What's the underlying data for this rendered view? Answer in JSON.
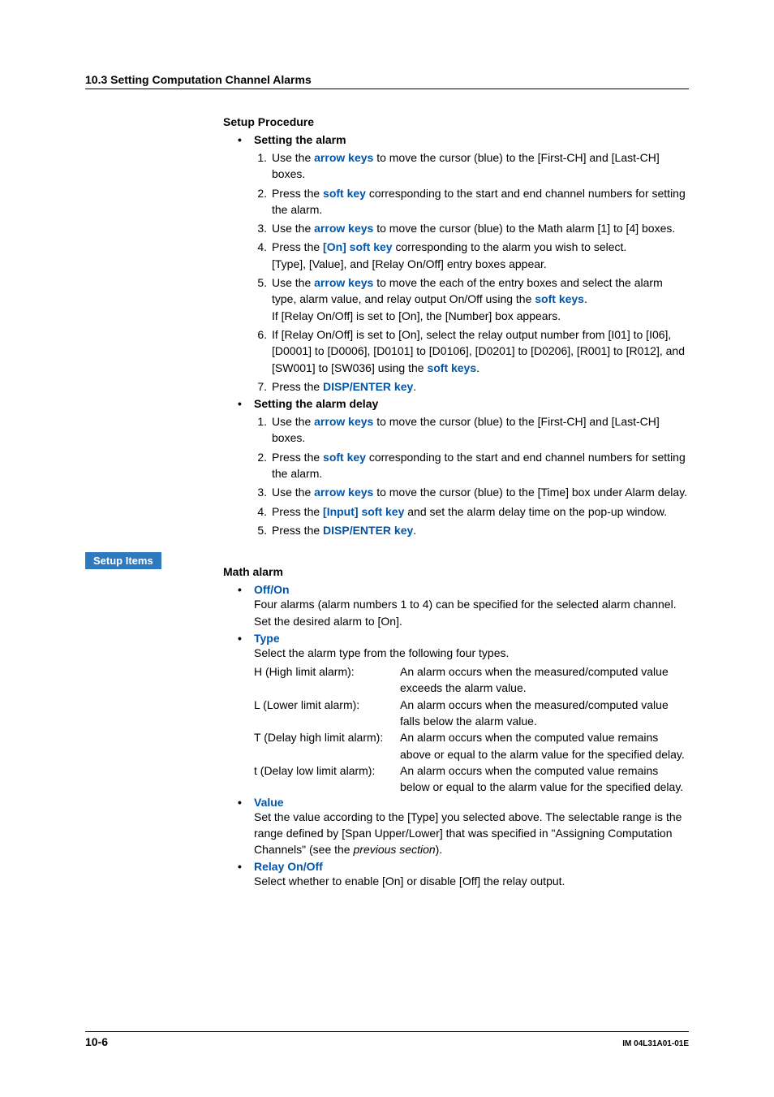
{
  "header": {
    "section": "10.3  Setting Computation Channel Alarms"
  },
  "setupProcedure": {
    "title": "Setup Procedure",
    "alarm": {
      "heading": "Setting the alarm",
      "steps": {
        "s1a": "Use the ",
        "s1b": "arrow keys",
        "s1c": " to move the cursor (blue) to the [First-CH] and [Last-CH] boxes.",
        "s2a": "Press the ",
        "s2b": "soft key",
        "s2c": " corresponding to the start and end channel numbers for setting the alarm.",
        "s3a": "Use the ",
        "s3b": "arrow keys",
        "s3c": " to move the cursor (blue) to the Math alarm [1] to [4] boxes.",
        "s4a": "Press the ",
        "s4b": "[On] soft key",
        "s4c": " corresponding to the alarm you wish to select.",
        "s4d": "[Type], [Value], and [Relay On/Off] entry boxes appear.",
        "s5a": "Use the ",
        "s5b": "arrow keys",
        "s5c": " to move the each of the entry boxes and select the alarm type, alarm value, and relay output On/Off using the ",
        "s5d": "soft keys",
        "s5e": ".",
        "s5f": "If [Relay On/Off] is set to [On], the [Number] box appears.",
        "s6a": "If [Relay On/Off] is set to [On], select the relay output number from [I01] to [I06], [D0001] to [D0006], [D0101] to [D0106], [D0201] to [D0206], [R001] to [R012], and [SW001] to [SW036] using the ",
        "s6b": "soft keys",
        "s6c": ".",
        "s7a": "Press the ",
        "s7b": "DISP/ENTER key",
        "s7c": "."
      }
    },
    "delay": {
      "heading": "Setting the alarm delay",
      "steps": {
        "s1a": "Use the ",
        "s1b": "arrow keys",
        "s1c": " to move the cursor (blue) to the [First-CH] and [Last-CH] boxes.",
        "s2a": "Press the ",
        "s2b": "soft key",
        "s2c": " corresponding to the start and end channel numbers for setting the alarm.",
        "s3a": "Use the ",
        "s3b": "arrow keys",
        "s3c": " to move the cursor (blue) to the [Time] box under Alarm delay.",
        "s4a": "Press the ",
        "s4b": "[Input] soft key",
        "s4c": " and set the alarm delay time on the pop-up window.",
        "s5a": "Press the ",
        "s5b": "DISP/ENTER key",
        "s5c": "."
      }
    }
  },
  "setupItems": {
    "badge": "Setup Items",
    "mathAlarm": "Math alarm",
    "offOn": {
      "heading": "Off/On",
      "text": "Four alarms (alarm numbers 1 to 4) can be specified for the selected alarm channel.  Set the desired alarm to [On]."
    },
    "type": {
      "heading": "Type",
      "intro": "Select the alarm type from the following four types.",
      "rows": {
        "r1l": "H (High limit alarm):",
        "r1d": "An alarm occurs when the measured/computed value exceeds the alarm value.",
        "r2l": "L (Lower limit alarm):",
        "r2d": "An alarm occurs when the measured/computed value falls below the alarm value.",
        "r3l": "T (Delay high limit alarm):",
        "r3d": "An alarm occurs when the computed value remains above or equal to the alarm value for the specified delay.",
        "r4l": "t (Delay low limit alarm):",
        "r4d": "An alarm occurs when the computed value remains below or equal to the alarm value for the specified delay."
      }
    },
    "value": {
      "heading": "Value",
      "t1": "Set the value according to the [Type] you selected above.  The selectable range is the range defined by [Span Upper/Lower] that was specified in \"Assigning Computation Channels\" (see the ",
      "t2": "previous section",
      "t3": ")."
    },
    "relay": {
      "heading": "Relay On/Off",
      "text": "Select whether to enable [On] or disable [Off] the relay output."
    }
  },
  "footer": {
    "page": "10-6",
    "docid": "IM 04L31A01-01E"
  }
}
